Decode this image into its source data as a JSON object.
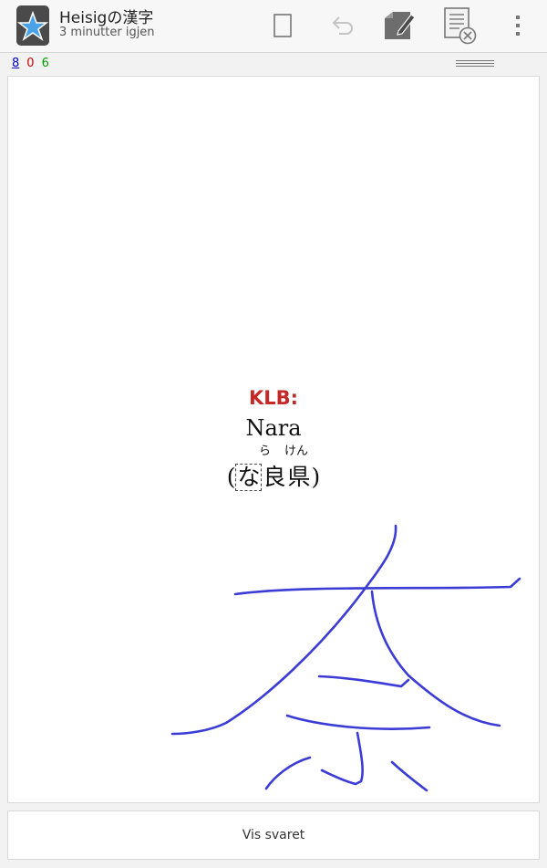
{
  "app": {
    "title": "Heisigの漢字",
    "subtitle": "3 minutter igjen"
  },
  "toolbar": {
    "icons": [
      "whiteboard-icon",
      "undo-icon",
      "edit-note-icon",
      "bury-card-icon",
      "overflow-menu-icon"
    ]
  },
  "counts": {
    "new": "8",
    "learning": "0",
    "review": "6"
  },
  "card": {
    "label": "KLB:",
    "word": "Nara",
    "furigana_1": "ら",
    "furigana_2": "けん",
    "open_paren": "(",
    "target_kana": "な",
    "kanji_1": "良",
    "kanji_2": "県",
    "close_paren": ")"
  },
  "drawn_character": "奈",
  "answer": {
    "button_label": "Vis svaret"
  },
  "colors": {
    "label_red": "#c62828",
    "stroke_blue": "#3b3bd6",
    "new_blue": "#0000cc",
    "learn_red": "#cc0000",
    "review_green": "#009900"
  }
}
